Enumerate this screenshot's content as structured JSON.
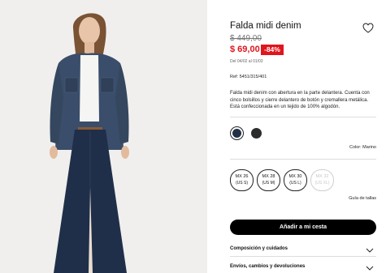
{
  "product": {
    "image_alt": "Modelo con falda midi denim y sobrecamisa vaquera",
    "title": "Falda midi denim",
    "old_price": "$ 449,00",
    "price": "$ 69,00",
    "discount": "-84%",
    "dates": "Del 04/02 al 01/03",
    "ref": "Ref: 5451/315/401",
    "description": "Falda midi denim con abertura en la parte delantera. Cuenta con cinco bolsillos y cierre delantero de botón y cremallera metálica. Está confeccionada en un tejido de 100% algodón."
  },
  "colors": {
    "swatches": [
      {
        "name": "Marino",
        "hex": "#223047",
        "selected": true
      },
      {
        "name": "Negro",
        "hex": "#2c2c2c",
        "selected": false
      }
    ],
    "label": "Color: Marino"
  },
  "sizes": [
    {
      "mx": "MX 26",
      "us": "(US S)",
      "available": true
    },
    {
      "mx": "MX 28",
      "us": "(US M)",
      "available": true
    },
    {
      "mx": "MX 30",
      "us": "(US L)",
      "available": true
    },
    {
      "mx": "MX 32",
      "us": "(US XL)",
      "available": false
    }
  ],
  "size_guide": "Guía de tallas",
  "add_to_cart": "Añadir a mi cesta",
  "accordions": [
    {
      "label": "Composición y cuidados"
    },
    {
      "label": "Envíos, cambios y devoluciones"
    }
  ],
  "icons": {
    "favorite": "heart-icon",
    "expand": "chevron-down-icon"
  }
}
